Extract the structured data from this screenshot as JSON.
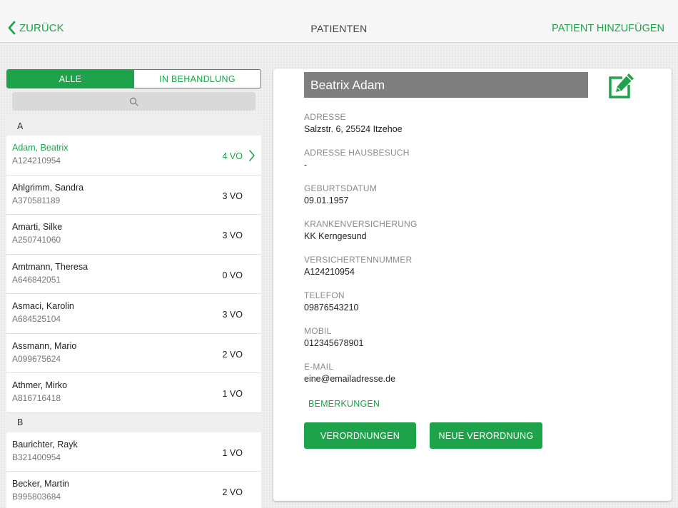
{
  "header": {
    "back_label": "ZURÜCK",
    "title": "PATIENTEN",
    "add_label": "PATIENT HINZUFÜGEN"
  },
  "filter": {
    "all_label": "ALLE",
    "treatment_label": "IN BEHANDLUNG"
  },
  "search": {
    "icon": "search-icon"
  },
  "list": {
    "sections": [
      {
        "letter": "A",
        "patients": [
          {
            "name": "Adam, Beatrix",
            "number": "A124210954",
            "count": "4 VO",
            "selected": true
          },
          {
            "name": "Ahlgrimm, Sandra",
            "number": "A370581189",
            "count": "3 VO"
          },
          {
            "name": "Amarti, Silke",
            "number": "A250741060",
            "count": "3 VO"
          },
          {
            "name": "Amtmann, Theresa",
            "number": "A646842051",
            "count": "0 VO"
          },
          {
            "name": "Asmaci, Karolin",
            "number": "A684525104",
            "count": "3 VO"
          },
          {
            "name": "Assmann, Mario",
            "number": "A099675624",
            "count": "2 VO"
          },
          {
            "name": "Athmer, Mirko",
            "number": "A816716418",
            "count": "1 VO"
          }
        ]
      },
      {
        "letter": "B",
        "patients": [
          {
            "name": "Baurichter, Rayk",
            "number": "B321400954",
            "count": "1 VO"
          },
          {
            "name": "Becker, Martin",
            "number": "B995803684",
            "count": "2 VO"
          }
        ]
      }
    ]
  },
  "detail": {
    "name": "Beatrix Adam",
    "fields": [
      {
        "label": "ADRESSE",
        "value": "Salzstr. 6, 25524 Itzehoe"
      },
      {
        "label": "ADRESSE HAUSBESUCH",
        "value": "-"
      },
      {
        "label": "GEBURTSDATUM",
        "value": "09.01.1957"
      },
      {
        "label": "KRANKENVERSICHERUNG",
        "value": "KK Kerngesund"
      },
      {
        "label": "VERSICHERTENNUMMER",
        "value": "A124210954"
      },
      {
        "label": "TELEFON",
        "value": "09876543210"
      },
      {
        "label": "MOBIL",
        "value": "012345678901"
      },
      {
        "label": "E-MAIL",
        "value": "eine@emailadresse.de"
      }
    ],
    "remarks_label": "BEMERKUNGEN",
    "prescriptions_label": "VERORDNUNGEN",
    "new_prescription_label": "NEUE VERORDNUNG"
  },
  "colors": {
    "accent": "#1ea34b",
    "name_bar": "#7f7f7f"
  }
}
